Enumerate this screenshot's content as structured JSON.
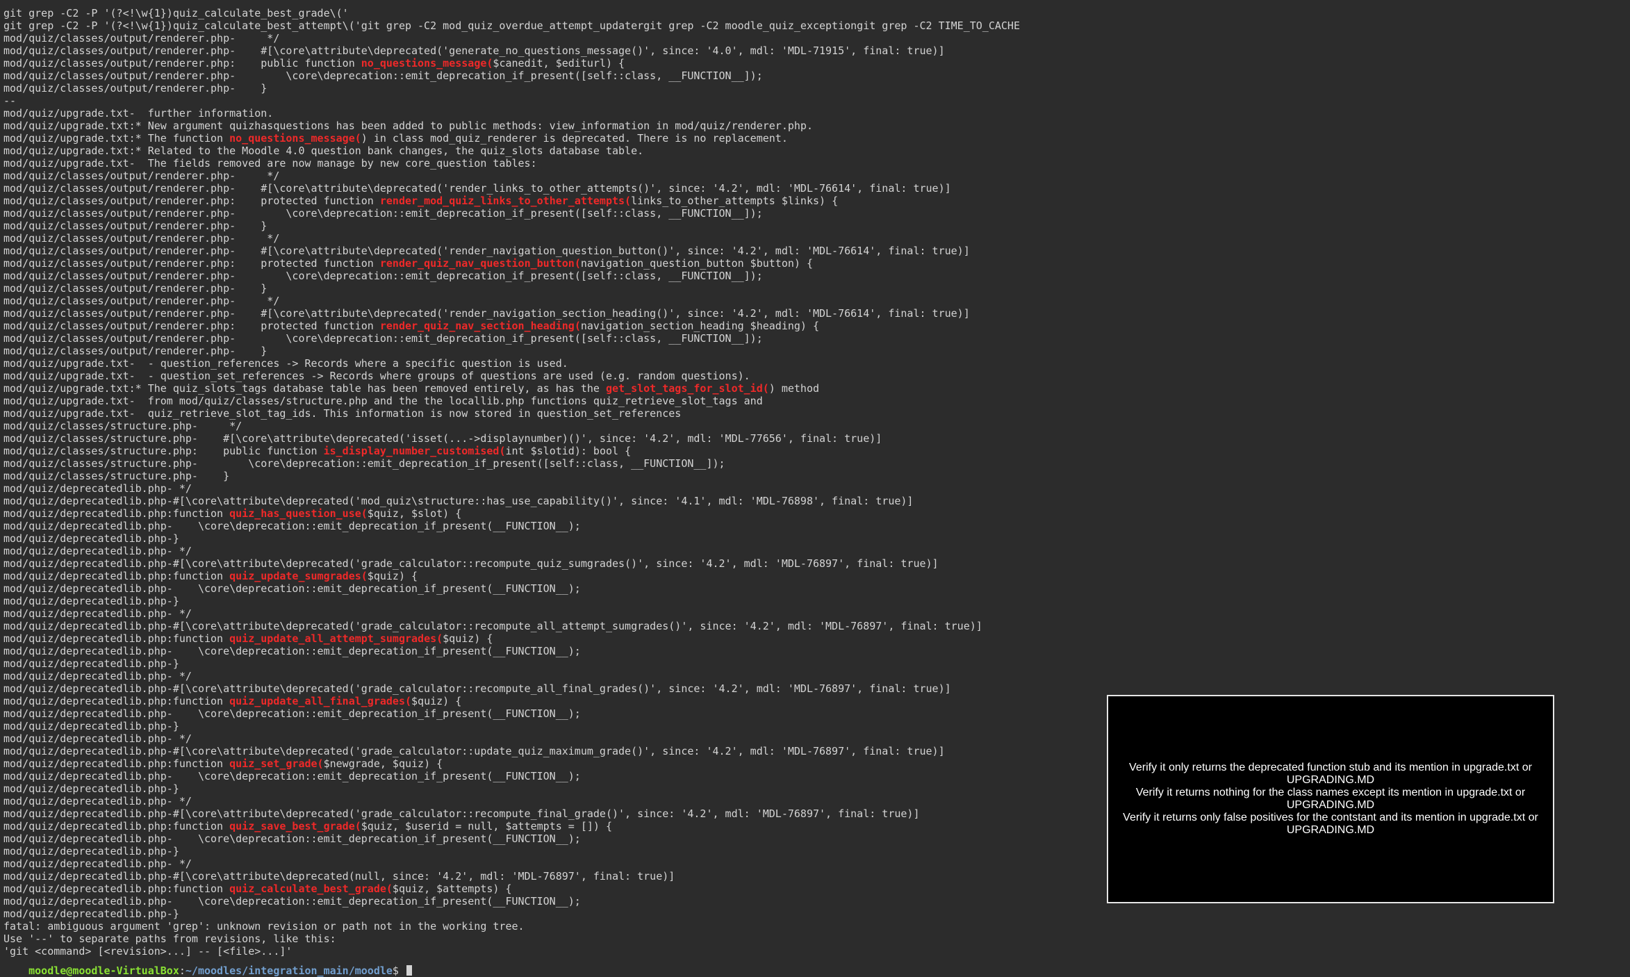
{
  "terminal": {
    "background": "#2c2c2c",
    "text_color": "#d3d3d3",
    "highlight_color": "#ef2929",
    "prompt_user_color": "#8ae234",
    "prompt_path_color": "#729fcf",
    "lines": [
      [
        {
          "t": "git grep -C2 -P '(?<!\\w{1})quiz_calculate_best_grade\\('"
        }
      ],
      [
        {
          "t": "git grep -C2 -P '(?<!\\w{1})quiz_calculate_best_attempt\\('git grep -C2 mod_quiz_overdue_attempt_updatergit grep -C2 moodle_quiz_exceptiongit grep -C2 TIME_TO_CACHE"
        }
      ],
      [
        {
          "t": "mod/quiz/classes/output/renderer.php-     */"
        }
      ],
      [
        {
          "t": "mod/quiz/classes/output/renderer.php-    #[\\core\\attribute\\deprecated('generate_no_questions_message()', since: '4.0', mdl: 'MDL-71915', final: true)]"
        }
      ],
      [
        {
          "t": "mod/quiz/classes/output/renderer.php:    public function "
        },
        {
          "t": "no_questions_message(",
          "h": true
        },
        {
          "t": "$canedit, $editurl) {"
        }
      ],
      [
        {
          "t": "mod/quiz/classes/output/renderer.php-        \\core\\deprecation::emit_deprecation_if_present([self::class, __FUNCTION__]);"
        }
      ],
      [
        {
          "t": "mod/quiz/classes/output/renderer.php-    }"
        }
      ],
      [
        {
          "t": "--"
        }
      ],
      [
        {
          "t": "mod/quiz/upgrade.txt-  further information."
        }
      ],
      [
        {
          "t": "mod/quiz/upgrade.txt:* New argument quizhasquestions has been added to public methods: view_information in mod/quiz/renderer.php."
        }
      ],
      [
        {
          "t": "mod/quiz/upgrade.txt:* The function "
        },
        {
          "t": "no_questions_message(",
          "h": true
        },
        {
          "t": ") in class mod_quiz_renderer is deprecated. There is no replacement."
        }
      ],
      [
        {
          "t": "mod/quiz/upgrade.txt:* Related to the Moodle 4.0 question bank changes, the quiz_slots database table."
        }
      ],
      [
        {
          "t": "mod/quiz/upgrade.txt-  The fields removed are now manage by new core_question tables:"
        }
      ],
      [
        {
          "t": "mod/quiz/classes/output/renderer.php-     */"
        }
      ],
      [
        {
          "t": "mod/quiz/classes/output/renderer.php-    #[\\core\\attribute\\deprecated('render_links_to_other_attempts()', since: '4.2', mdl: 'MDL-76614', final: true)]"
        }
      ],
      [
        {
          "t": "mod/quiz/classes/output/renderer.php:    protected function "
        },
        {
          "t": "render_mod_quiz_links_to_other_attempts(",
          "h": true
        },
        {
          "t": "links_to_other_attempts $links) {"
        }
      ],
      [
        {
          "t": "mod/quiz/classes/output/renderer.php-        \\core\\deprecation::emit_deprecation_if_present([self::class, __FUNCTION__]);"
        }
      ],
      [
        {
          "t": "mod/quiz/classes/output/renderer.php-    }"
        }
      ],
      [
        {
          "t": "mod/quiz/classes/output/renderer.php-     */"
        }
      ],
      [
        {
          "t": "mod/quiz/classes/output/renderer.php-    #[\\core\\attribute\\deprecated('render_navigation_question_button()', since: '4.2', mdl: 'MDL-76614', final: true)]"
        }
      ],
      [
        {
          "t": "mod/quiz/classes/output/renderer.php:    protected function "
        },
        {
          "t": "render_quiz_nav_question_button(",
          "h": true
        },
        {
          "t": "navigation_question_button $button) {"
        }
      ],
      [
        {
          "t": "mod/quiz/classes/output/renderer.php-        \\core\\deprecation::emit_deprecation_if_present([self::class, __FUNCTION__]);"
        }
      ],
      [
        {
          "t": "mod/quiz/classes/output/renderer.php-    }"
        }
      ],
      [
        {
          "t": "mod/quiz/classes/output/renderer.php-     */"
        }
      ],
      [
        {
          "t": "mod/quiz/classes/output/renderer.php-    #[\\core\\attribute\\deprecated('render_navigation_section_heading()', since: '4.2', mdl: 'MDL-76614', final: true)]"
        }
      ],
      [
        {
          "t": "mod/quiz/classes/output/renderer.php:    protected function "
        },
        {
          "t": "render_quiz_nav_section_heading(",
          "h": true
        },
        {
          "t": "navigation_section_heading $heading) {"
        }
      ],
      [
        {
          "t": "mod/quiz/classes/output/renderer.php-        \\core\\deprecation::emit_deprecation_if_present([self::class, __FUNCTION__]);"
        }
      ],
      [
        {
          "t": "mod/quiz/classes/output/renderer.php-    }"
        }
      ],
      [
        {
          "t": "mod/quiz/upgrade.txt-  - question_references -> Records where a specific question is used."
        }
      ],
      [
        {
          "t": "mod/quiz/upgrade.txt-  - question_set_references -> Records where groups of questions are used (e.g. random questions)."
        }
      ],
      [
        {
          "t": "mod/quiz/upgrade.txt:* The quiz_slots_tags database table has been removed entirely, as has the "
        },
        {
          "t": "get_slot_tags_for_slot_id(",
          "h": true
        },
        {
          "t": ") method"
        }
      ],
      [
        {
          "t": "mod/quiz/upgrade.txt-  from mod/quiz/classes/structure.php and the the locallib.php functions quiz_retrieve_slot_tags and"
        }
      ],
      [
        {
          "t": "mod/quiz/upgrade.txt-  quiz_retrieve_slot_tag_ids. This information is now stored in question_set_references"
        }
      ],
      [
        {
          "t": "mod/quiz/classes/structure.php-     */"
        }
      ],
      [
        {
          "t": "mod/quiz/classes/structure.php-    #[\\core\\attribute\\deprecated('isset(...->displaynumber)()', since: '4.2', mdl: 'MDL-77656', final: true)]"
        }
      ],
      [
        {
          "t": "mod/quiz/classes/structure.php:    public function "
        },
        {
          "t": "is_display_number_customised(",
          "h": true
        },
        {
          "t": "int $slotid): bool {"
        }
      ],
      [
        {
          "t": "mod/quiz/classes/structure.php-        \\core\\deprecation::emit_deprecation_if_present([self::class, __FUNCTION__]);"
        }
      ],
      [
        {
          "t": "mod/quiz/classes/structure.php-    }"
        }
      ],
      [
        {
          "t": "mod/quiz/deprecatedlib.php- */"
        }
      ],
      [
        {
          "t": "mod/quiz/deprecatedlib.php-#[\\core\\attribute\\deprecated('mod_quiz\\structure::has_use_capability()', since: '4.1', mdl: 'MDL-76898', final: true)]"
        }
      ],
      [
        {
          "t": "mod/quiz/deprecatedlib.php:function "
        },
        {
          "t": "quiz_has_question_use(",
          "h": true
        },
        {
          "t": "$quiz, $slot) {"
        }
      ],
      [
        {
          "t": "mod/quiz/deprecatedlib.php-    \\core\\deprecation::emit_deprecation_if_present(__FUNCTION__);"
        }
      ],
      [
        {
          "t": "mod/quiz/deprecatedlib.php-}"
        }
      ],
      [
        {
          "t": "mod/quiz/deprecatedlib.php- */"
        }
      ],
      [
        {
          "t": "mod/quiz/deprecatedlib.php-#[\\core\\attribute\\deprecated('grade_calculator::recompute_quiz_sumgrades()', since: '4.2', mdl: 'MDL-76897', final: true)]"
        }
      ],
      [
        {
          "t": "mod/quiz/deprecatedlib.php:function "
        },
        {
          "t": "quiz_update_sumgrades(",
          "h": true
        },
        {
          "t": "$quiz) {"
        }
      ],
      [
        {
          "t": "mod/quiz/deprecatedlib.php-    \\core\\deprecation::emit_deprecation_if_present(__FUNCTION__);"
        }
      ],
      [
        {
          "t": "mod/quiz/deprecatedlib.php-}"
        }
      ],
      [
        {
          "t": "mod/quiz/deprecatedlib.php- */"
        }
      ],
      [
        {
          "t": "mod/quiz/deprecatedlib.php-#[\\core\\attribute\\deprecated('grade_calculator::recompute_all_attempt_sumgrades()', since: '4.2', mdl: 'MDL-76897', final: true)]"
        }
      ],
      [
        {
          "t": "mod/quiz/deprecatedlib.php:function "
        },
        {
          "t": "quiz_update_all_attempt_sumgrades(",
          "h": true
        },
        {
          "t": "$quiz) {"
        }
      ],
      [
        {
          "t": "mod/quiz/deprecatedlib.php-    \\core\\deprecation::emit_deprecation_if_present(__FUNCTION__);"
        }
      ],
      [
        {
          "t": "mod/quiz/deprecatedlib.php-}"
        }
      ],
      [
        {
          "t": "mod/quiz/deprecatedlib.php- */"
        }
      ],
      [
        {
          "t": "mod/quiz/deprecatedlib.php-#[\\core\\attribute\\deprecated('grade_calculator::recompute_all_final_grades()', since: '4.2', mdl: 'MDL-76897', final: true)]"
        }
      ],
      [
        {
          "t": "mod/quiz/deprecatedlib.php:function "
        },
        {
          "t": "quiz_update_all_final_grades(",
          "h": true
        },
        {
          "t": "$quiz) {"
        }
      ],
      [
        {
          "t": "mod/quiz/deprecatedlib.php-    \\core\\deprecation::emit_deprecation_if_present(__FUNCTION__);"
        }
      ],
      [
        {
          "t": "mod/quiz/deprecatedlib.php-}"
        }
      ],
      [
        {
          "t": "mod/quiz/deprecatedlib.php- */"
        }
      ],
      [
        {
          "t": "mod/quiz/deprecatedlib.php-#[\\core\\attribute\\deprecated('grade_calculator::update_quiz_maximum_grade()', since: '4.2', mdl: 'MDL-76897', final: true)]"
        }
      ],
      [
        {
          "t": "mod/quiz/deprecatedlib.php:function "
        },
        {
          "t": "quiz_set_grade(",
          "h": true
        },
        {
          "t": "$newgrade, $quiz) {"
        }
      ],
      [
        {
          "t": "mod/quiz/deprecatedlib.php-    \\core\\deprecation::emit_deprecation_if_present(__FUNCTION__);"
        }
      ],
      [
        {
          "t": "mod/quiz/deprecatedlib.php-}"
        }
      ],
      [
        {
          "t": "mod/quiz/deprecatedlib.php- */"
        }
      ],
      [
        {
          "t": "mod/quiz/deprecatedlib.php-#[\\core\\attribute\\deprecated('grade_calculator::recompute_final_grade()', since: '4.2', mdl: 'MDL-76897', final: true)]"
        }
      ],
      [
        {
          "t": "mod/quiz/deprecatedlib.php:function "
        },
        {
          "t": "quiz_save_best_grade(",
          "h": true
        },
        {
          "t": "$quiz, $userid = null, $attempts = []) {"
        }
      ],
      [
        {
          "t": "mod/quiz/deprecatedlib.php-    \\core\\deprecation::emit_deprecation_if_present(__FUNCTION__);"
        }
      ],
      [
        {
          "t": "mod/quiz/deprecatedlib.php-}"
        }
      ],
      [
        {
          "t": "mod/quiz/deprecatedlib.php- */"
        }
      ],
      [
        {
          "t": "mod/quiz/deprecatedlib.php-#[\\core\\attribute\\deprecated(null, since: '4.2', mdl: 'MDL-76897', final: true)]"
        }
      ],
      [
        {
          "t": "mod/quiz/deprecatedlib.php:function "
        },
        {
          "t": "quiz_calculate_best_grade(",
          "h": true
        },
        {
          "t": "$quiz, $attempts) {"
        }
      ],
      [
        {
          "t": "mod/quiz/deprecatedlib.php-    \\core\\deprecation::emit_deprecation_if_present(__FUNCTION__);"
        }
      ],
      [
        {
          "t": "mod/quiz/deprecatedlib.php-}"
        }
      ],
      [
        {
          "t": "fatal: ambiguous argument 'grep': unknown revision or path not in the working tree."
        }
      ],
      [
        {
          "t": "Use '--' to separate paths from revisions, like this:"
        }
      ],
      [
        {
          "t": "'git <command> [<revision>...] -- [<file>...]'"
        }
      ]
    ],
    "prompt": {
      "user_host": "moodle@moodle-VirtualBox",
      "separator": ":",
      "path": "~/moodles/integration_main/moodle",
      "symbol": "$ "
    }
  },
  "overlay": {
    "background": "#000000",
    "border_color": "#e6e6e6",
    "notes": [
      "Verify it only returns the deprecated function stub and its mention in upgrade.txt or UPGRADING.MD",
      "Verify it returns nothing for the class names except its mention in upgrade.txt or UPGRADING.MD",
      "Verify it returns only false positives for the contstant and its mention in upgrade.txt or UPGRADING.MD"
    ]
  }
}
